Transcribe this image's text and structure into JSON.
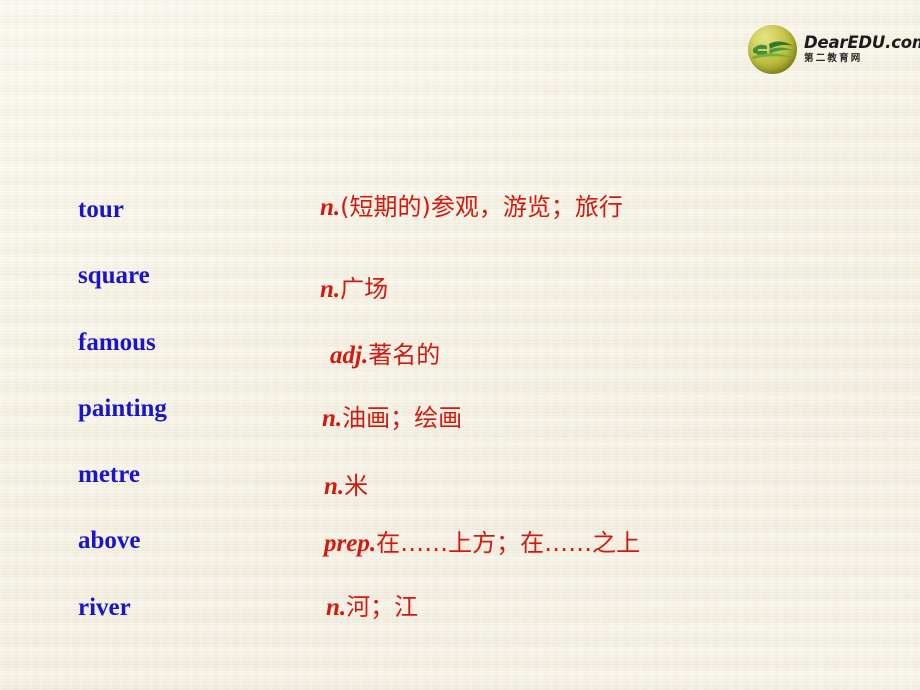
{
  "slide": {
    "background_color": "#f6f2e6",
    "term_color": "#1a16c8",
    "definition_color": "#d4190f"
  },
  "logo": {
    "name": "dearedu-logo",
    "title": "DearEDU.com",
    "subtitle": "第二教育网",
    "mark_colors": {
      "sphere": "#bdbe3d",
      "swoosh": "#3f8f3f"
    }
  },
  "vocabulary": [
    {
      "term": "tour",
      "part_of_speech": "n.",
      "meaning": "(短期的)参观，游览；旅行"
    },
    {
      "term": "square",
      "part_of_speech": "n.",
      "meaning": "广场"
    },
    {
      "term": "famous",
      "part_of_speech": "adj.",
      "meaning": "著名的"
    },
    {
      "term": "painting",
      "part_of_speech": "n.",
      "meaning": "油画；绘画"
    },
    {
      "term": "metre",
      "part_of_speech": "n.",
      "meaning": "米"
    },
    {
      "term": "above",
      "part_of_speech": "prep.",
      "meaning": "在……上方；在……之上"
    },
    {
      "term": "river",
      "part_of_speech": "n.",
      "meaning": "河；江"
    }
  ]
}
